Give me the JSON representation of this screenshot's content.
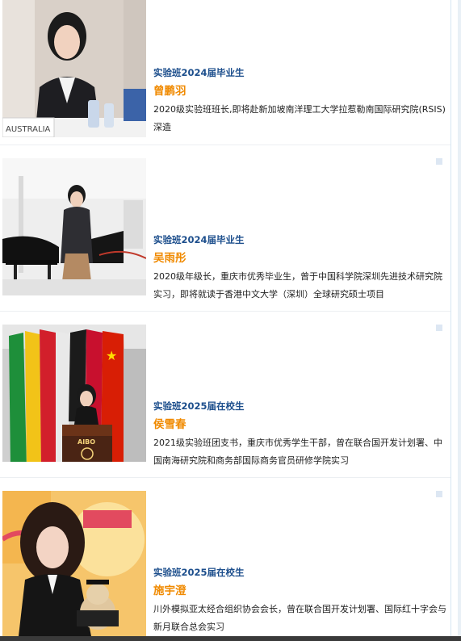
{
  "profiles": [
    {
      "class_line": "实验班2024届毕业生",
      "name": "曾鹏羽",
      "description": "2020级实验班班长,即将赴新加坡南洋理工大学拉惹勒南国际研究院(RSIS)深造",
      "image_alt": "photo-at-conference-table",
      "placard_text": "AUSTRALIA"
    },
    {
      "class_line": "实验班2024届毕业生",
      "name": "吴雨彤",
      "description": "2020级年级长，重庆市优秀毕业生，曾于中国科学院深圳先进技术研究院实习，即将就读于香港中文大学（深圳）全球研究硕士项目",
      "image_alt": "photo-next-to-piano"
    },
    {
      "class_line": "实验班2025届在校生",
      "name": "侯雪春",
      "description": "2021级实验班团支书，重庆市优秀学生干部，曾在联合国开发计划署、中国南海研究院和商务部国际商务官员研修学院实习",
      "image_alt": "photo-at-podium-with-flags",
      "podium_text": "AIBO"
    },
    {
      "class_line": "实验班2025届在校生",
      "name": "施宇澄",
      "description": "川外模拟亚太经合组织协会会长，曾在联合国开发计划署、国际红十字会与新月联合总会实习",
      "image_alt": "photo-in-graduation-gown"
    }
  ],
  "colors": {
    "class_line": "#1c4e8c",
    "name": "#f08a00",
    "text": "#222222"
  }
}
